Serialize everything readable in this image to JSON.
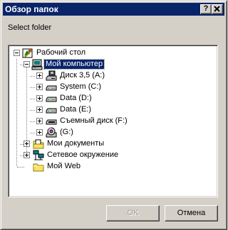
{
  "window": {
    "title": "Обзор папок",
    "help_button": "?",
    "close_button": "✕"
  },
  "prompt": "Select folder",
  "tree": {
    "items": [
      {
        "label": "Рабочий стол",
        "icon": "desktop-icon",
        "expanded": true
      },
      {
        "label": "Мой компьютер",
        "icon": "computer-icon",
        "expanded": true,
        "selected": true
      },
      {
        "label": "Диск 3,5 (A:)",
        "icon": "floppy-drive-icon"
      },
      {
        "label": "System (C:)",
        "icon": "hard-drive-icon"
      },
      {
        "label": "Data (D:)",
        "icon": "hard-drive-icon"
      },
      {
        "label": "Data (E:)",
        "icon": "hard-drive-icon"
      },
      {
        "label": "Съемный диск (F:)",
        "icon": "removable-drive-icon"
      },
      {
        "label": "(G:)",
        "icon": "cd-drive-icon"
      },
      {
        "label": "Мои документы",
        "icon": "documents-folder-icon"
      },
      {
        "label": "Сетевое окружение",
        "icon": "network-icon"
      },
      {
        "label": "Мой Web",
        "icon": "folder-icon"
      }
    ]
  },
  "buttons": {
    "ok": "OK",
    "cancel": "Отмена"
  }
}
